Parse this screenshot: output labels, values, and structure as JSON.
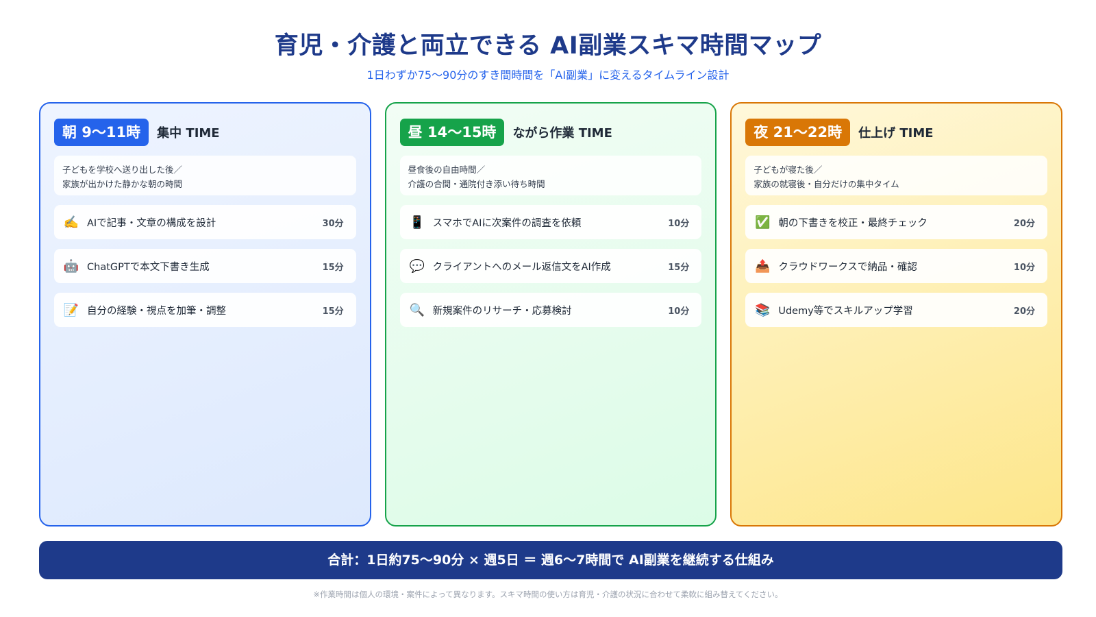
{
  "header": {
    "title": "育児・介護と両立できる AI副業スキマ時間マップ",
    "subtitle": "1日わずか75〜90分のすき間時間を「AI副業」に変えるタイムライン設計"
  },
  "columns": [
    {
      "badge": "朝 9〜11時",
      "label": "集中 TIME",
      "desc": [
        "子どもを学校へ送り出した後／",
        "家族が出かけた静かな朝の時間"
      ],
      "tasks": [
        {
          "icon": "✍️",
          "text": "AIで記事・文章の構成を設計",
          "min": "30分"
        },
        {
          "icon": "🤖",
          "text": "ChatGPTで本文下書き生成",
          "min": "15分"
        },
        {
          "icon": "📝",
          "text": "自分の経験・視点を加筆・調整",
          "min": "15分"
        }
      ]
    },
    {
      "badge": "昼 14〜15時",
      "label": "ながら作業 TIME",
      "desc": [
        "昼食後の自由時間／",
        "介護の合間・通院付き添い待ち時間"
      ],
      "tasks": [
        {
          "icon": "📱",
          "text": "スマホでAIに次案件の調査を依頼",
          "min": "10分"
        },
        {
          "icon": "💬",
          "text": "クライアントへのメール返信文をAI作成",
          "min": "15分"
        },
        {
          "icon": "🔍",
          "text": "新規案件のリサーチ・応募検討",
          "min": "10分"
        }
      ]
    },
    {
      "badge": "夜 21〜22時",
      "label": "仕上げ TIME",
      "desc": [
        "子どもが寝た後／",
        "家族の就寝後・自分だけの集中タイム"
      ],
      "tasks": [
        {
          "icon": "✅",
          "text": "朝の下書きを校正・最終チェック",
          "min": "20分"
        },
        {
          "icon": "📤",
          "text": "クラウドワークスで納品・確認",
          "min": "10分"
        },
        {
          "icon": "📚",
          "text": "Udemy等でスキルアップ学習",
          "min": "20分"
        }
      ]
    }
  ],
  "summary": "合計：1日約75〜90分 × 週5日 ＝ 週6〜7時間で AI副業を継続する仕組み",
  "footnote": "※作業時間は個人の環境・案件によって異なります。スキマ時間の使い方は育児・介護の状況に合わせて柔軟に組み替えてください。",
  "colors": {
    "morning": "#2563eb",
    "noon": "#16a34a",
    "night": "#d97706",
    "banner": "#1e3a8a"
  },
  "icons": {
    "columns": [
      [
        "writing-hand-icon",
        "robot-icon",
        "memo-icon"
      ],
      [
        "mobile-phone-icon",
        "speech-bubble-icon",
        "magnifier-icon"
      ],
      [
        "check-mark-icon",
        "outbox-tray-icon",
        "books-icon"
      ]
    ]
  }
}
